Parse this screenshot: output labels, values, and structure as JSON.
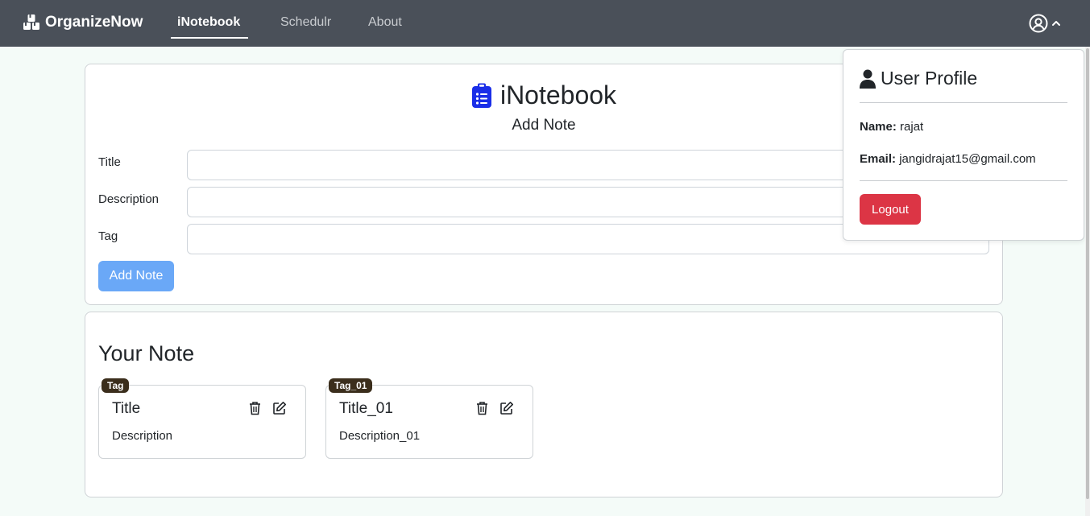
{
  "navbar": {
    "brand": "OrganizeNow",
    "links": [
      "iNotebook",
      "Schedulr",
      "About"
    ],
    "active": "iNotebook"
  },
  "add_card": {
    "app_title": "iNotebook",
    "subtitle": "Add Note",
    "fields": {
      "title_label": "Title",
      "description_label": "Description",
      "tag_label": "Tag",
      "title_value": "",
      "description_value": "",
      "tag_value": ""
    },
    "add_button": "Add Note"
  },
  "notes_section": {
    "heading": "Your Note",
    "notes": [
      {
        "tag": "Tag",
        "title": "Title",
        "description": "Description"
      },
      {
        "tag": "Tag_01",
        "title": "Title_01",
        "description": "Description_01"
      }
    ]
  },
  "profile": {
    "title": "User Profile",
    "name_label": "Name:",
    "name_value": "rajat",
    "email_label": "Email:",
    "email_value": "jangidrajat15@gmail.com",
    "logout_button": "Logout"
  },
  "colors": {
    "navbar": "#4a5059",
    "add_button": "#6aa8f7",
    "logout_button": "#dc3545",
    "tag_badge": "#3b2e1c",
    "app_icon": "#1a2ee8"
  },
  "icons": [
    "boxes-icon",
    "user-circle-icon",
    "chevron-up-icon",
    "clipboard-list-icon",
    "person-icon",
    "trash-icon",
    "edit-icon"
  ]
}
